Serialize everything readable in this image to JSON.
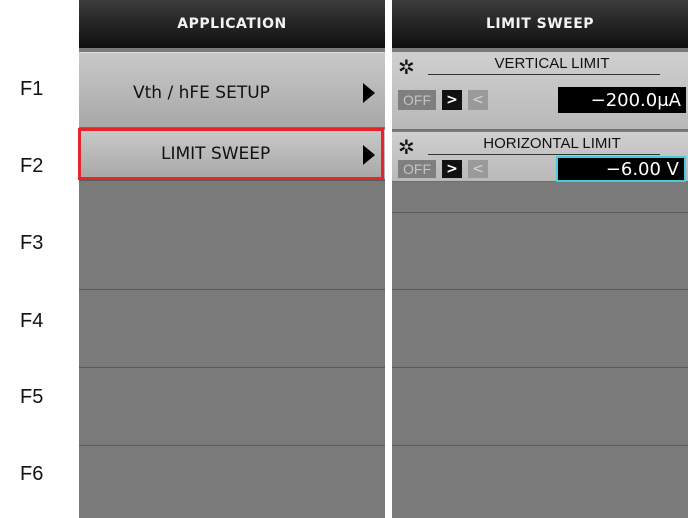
{
  "fkeys": [
    "F1",
    "F2",
    "F3",
    "F4",
    "F5",
    "F6"
  ],
  "application_panel": {
    "title": "APPLICATION",
    "items": [
      {
        "label": "Vth / hFE SETUP"
      },
      {
        "label": "LIMIT SWEEP",
        "selected": true
      }
    ]
  },
  "limit_sweep_panel": {
    "title": "LIMIT SWEEP",
    "vertical": {
      "title": "VERTICAL LIMIT",
      "off": "OFF",
      "gt": ">",
      "lt": "<",
      "value": "−200.0μA"
    },
    "horizontal": {
      "title": "HORIZONTAL LIMIT",
      "off": "OFF",
      "gt": ">",
      "lt": "<",
      "value": "−6.00 V"
    }
  },
  "colors": {
    "highlight": "#e8232a",
    "focus_border": "#3fd0e0",
    "panel_bg": "#7a7a7a"
  },
  "icons": {
    "gear": "gear-icon",
    "arrow": "triangle-right-icon"
  }
}
